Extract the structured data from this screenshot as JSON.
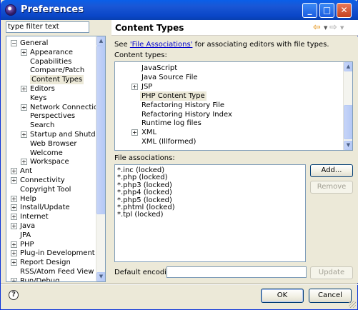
{
  "window": {
    "title": "Preferences",
    "minimize": "_",
    "maximize": "□",
    "close": "✕"
  },
  "filter": {
    "value": "type filter text"
  },
  "left_tree": [
    {
      "label": "General",
      "depth": 0,
      "expander": "−"
    },
    {
      "label": "Appearance",
      "depth": 1,
      "expander": "+"
    },
    {
      "label": "Capabilities",
      "depth": 1,
      "expander": ""
    },
    {
      "label": "Compare/Patch",
      "depth": 1,
      "expander": ""
    },
    {
      "label": "Content Types",
      "depth": 1,
      "expander": "",
      "selected": true
    },
    {
      "label": "Editors",
      "depth": 1,
      "expander": "+"
    },
    {
      "label": "Keys",
      "depth": 1,
      "expander": ""
    },
    {
      "label": "Network Connections",
      "depth": 1,
      "expander": "+"
    },
    {
      "label": "Perspectives",
      "depth": 1,
      "expander": ""
    },
    {
      "label": "Search",
      "depth": 1,
      "expander": ""
    },
    {
      "label": "Startup and Shutdown",
      "depth": 1,
      "expander": "+"
    },
    {
      "label": "Web Browser",
      "depth": 1,
      "expander": ""
    },
    {
      "label": "Welcome",
      "depth": 1,
      "expander": ""
    },
    {
      "label": "Workspace",
      "depth": 1,
      "expander": "+"
    },
    {
      "label": "Ant",
      "depth": 0,
      "expander": "+"
    },
    {
      "label": "Connectivity",
      "depth": 0,
      "expander": "+"
    },
    {
      "label": "Copyright Tool",
      "depth": 0,
      "expander": ""
    },
    {
      "label": "Help",
      "depth": 0,
      "expander": "+"
    },
    {
      "label": "Install/Update",
      "depth": 0,
      "expander": "+"
    },
    {
      "label": "Internet",
      "depth": 0,
      "expander": "+"
    },
    {
      "label": "Java",
      "depth": 0,
      "expander": "+"
    },
    {
      "label": "JPA",
      "depth": 0,
      "expander": ""
    },
    {
      "label": "PHP",
      "depth": 0,
      "expander": "+"
    },
    {
      "label": "Plug-in Development",
      "depth": 0,
      "expander": "+"
    },
    {
      "label": "Report Design",
      "depth": 0,
      "expander": "+"
    },
    {
      "label": "RSS/Atom Feed View",
      "depth": 0,
      "expander": ""
    },
    {
      "label": "Run/Debug",
      "depth": 0,
      "expander": "+"
    }
  ],
  "page": {
    "title": "Content Types",
    "see_prefix": "See ",
    "see_link": "'File Associations'",
    "see_suffix": " for associating editors with file types.",
    "content_types_label": "Content types:",
    "file_assoc_label": "File associations:",
    "encoding_label": "Default encoding:",
    "encoding_value": ""
  },
  "content_types": [
    {
      "label": "JavaScript",
      "expander": ""
    },
    {
      "label": "Java Source File",
      "expander": ""
    },
    {
      "label": "JSP",
      "expander": "+"
    },
    {
      "label": "PHP Content Type",
      "expander": "",
      "selected": true
    },
    {
      "label": "Refactoring History File",
      "expander": ""
    },
    {
      "label": "Refactoring History Index",
      "expander": ""
    },
    {
      "label": "Runtime log files",
      "expander": ""
    },
    {
      "label": "XML",
      "expander": "+"
    },
    {
      "label": "XML (Illformed)",
      "expander": ""
    }
  ],
  "file_associations": [
    "*.inc (locked)",
    "*.php (locked)",
    "*.php3 (locked)",
    "*.php4 (locked)",
    "*.php5 (locked)",
    "*.phtml (locked)",
    "*.tpl (locked)"
  ],
  "buttons": {
    "add": "Add...",
    "remove": "Remove",
    "update": "Update",
    "ok": "OK",
    "cancel": "Cancel"
  },
  "icons": {
    "back": "arrow-left-icon",
    "forward": "arrow-right-icon",
    "help": "help-icon"
  }
}
